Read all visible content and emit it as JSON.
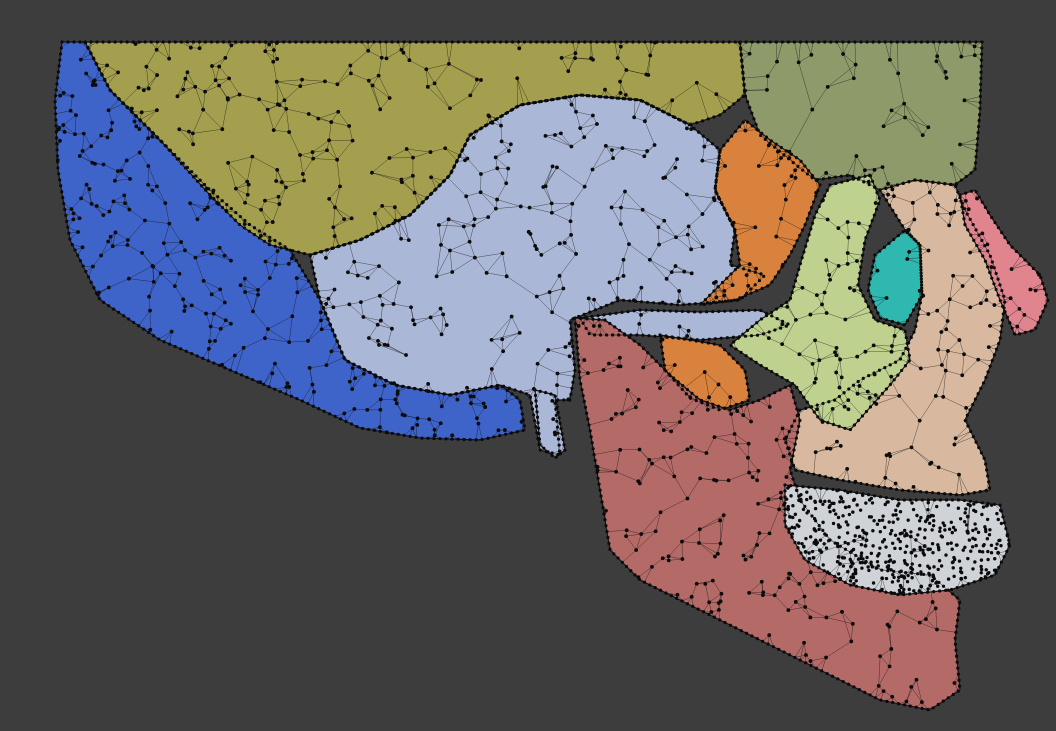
{
  "viewport": {
    "background": "#3d3d3d",
    "view": "lateral-right"
  },
  "model": {
    "subject": "skull",
    "render_style": "triangulated-wireframe-over-shaded",
    "wire_color": "#111111",
    "regions": [
      {
        "name": "parietal-bone",
        "color": "#a39f4f"
      },
      {
        "name": "occipital-bone",
        "color": "#3e63c9"
      },
      {
        "name": "temporal-bone",
        "color": "#aab7d6"
      },
      {
        "name": "frontal-bone",
        "color": "#8e9a6a"
      },
      {
        "name": "sphenoid-bone",
        "color": "#d9823e"
      },
      {
        "name": "zygomatic-bone",
        "color": "#bfd18f"
      },
      {
        "name": "maxilla",
        "color": "#d8b9a0"
      },
      {
        "name": "nasal-bone",
        "color": "#e0848e"
      },
      {
        "name": "lacrimal-bone",
        "color": "#2fb8b0"
      },
      {
        "name": "mandible",
        "color": "#b46a67"
      },
      {
        "name": "teeth",
        "color": "#cfd3d8"
      }
    ]
  }
}
